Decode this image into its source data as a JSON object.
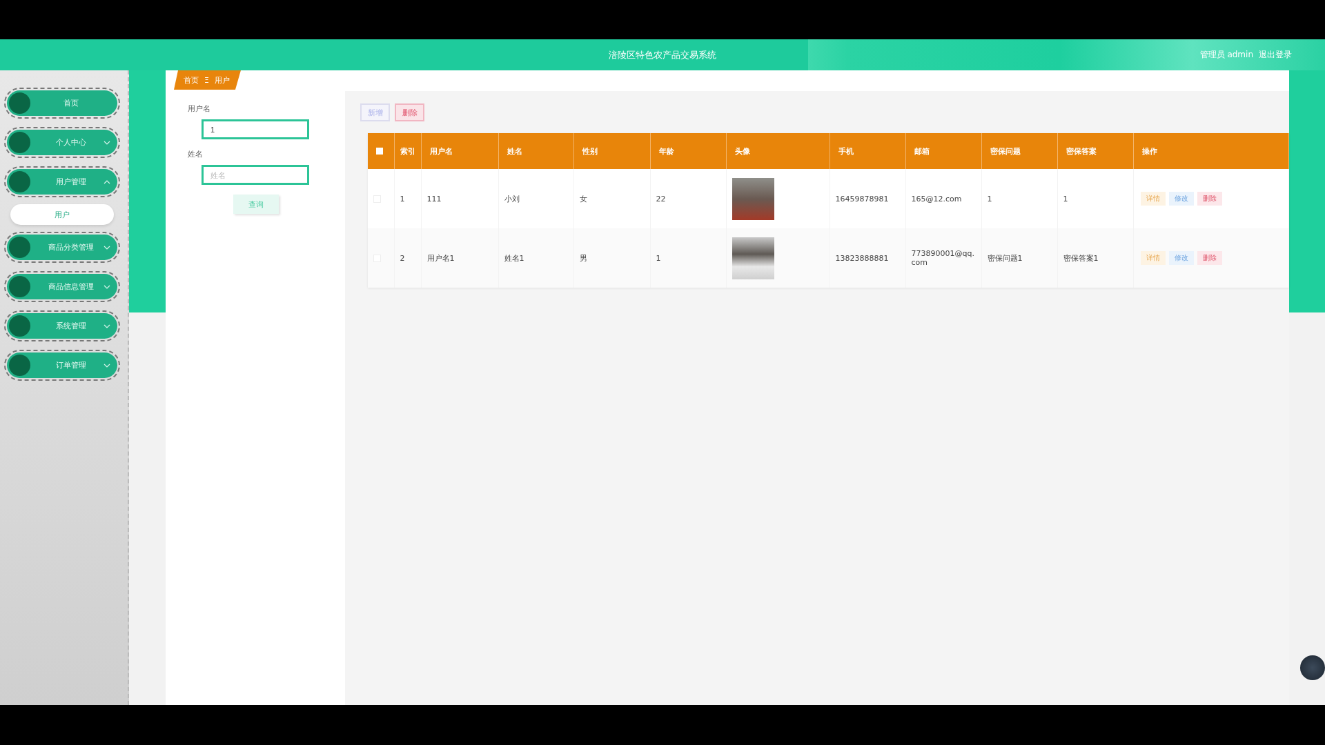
{
  "header": {
    "title": "涪陵区特色农产品交易系统",
    "user": "管理员 admin",
    "logout": "退出登录"
  },
  "sidebar": {
    "items": [
      {
        "label": "首页",
        "kind": "link"
      },
      {
        "label": "个人中心",
        "kind": "menu",
        "expanded": false
      },
      {
        "label": "用户管理",
        "kind": "menu",
        "expanded": true,
        "children": [
          {
            "label": "用户"
          }
        ]
      },
      {
        "label": "商品分类管理",
        "kind": "menu",
        "expanded": false
      },
      {
        "label": "商品信息管理",
        "kind": "menu",
        "expanded": false
      },
      {
        "label": "系统管理",
        "kind": "menu",
        "expanded": false
      },
      {
        "label": "订单管理",
        "kind": "menu",
        "expanded": false
      }
    ]
  },
  "breadcrumb": [
    "首页",
    "Ξ",
    "用户"
  ],
  "search": {
    "fields": [
      {
        "label": "用户名",
        "value": "1"
      },
      {
        "label": "姓名",
        "placeholder": "姓名"
      }
    ],
    "button": "查询"
  },
  "toolbar": {
    "add": "新增",
    "delete": "删除"
  },
  "table": {
    "select_all_checked": false,
    "columns": [
      "索引",
      "用户名",
      "姓名",
      "性别",
      "年龄",
      "头像",
      "手机",
      "邮箱",
      "密保问题",
      "密保答案",
      "操作"
    ],
    "rows": [
      {
        "checked": false,
        "cells": [
          "1",
          "111",
          "小刘",
          "女",
          "22"
        ],
        "phone": "16459878981",
        "email": "165@12.com",
        "question": "1",
        "answer": "1",
        "actions": [
          "详情",
          "修改",
          "删除"
        ]
      },
      {
        "checked": false,
        "cells": [
          "2",
          "用户名1",
          "姓名1",
          "男",
          "1"
        ],
        "phone": "13823888881",
        "email": "773890001@qq.com",
        "question": "密保问题1",
        "answer": "密保答案1",
        "actions": [
          "详情",
          "修改",
          "删除"
        ]
      }
    ]
  }
}
